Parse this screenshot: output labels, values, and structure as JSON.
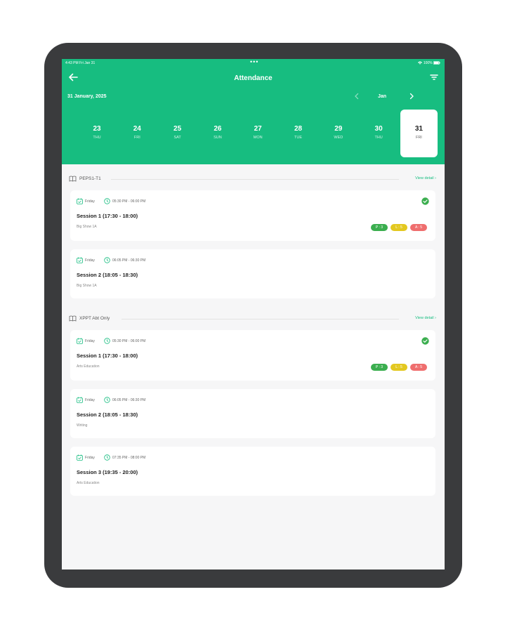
{
  "status_bar": {
    "time": "4:43 PM   Fri Jan 31",
    "dots": "•••",
    "battery": "100%"
  },
  "header": {
    "title": "Attendance",
    "date_text": "31 January, 2025",
    "month_label": "Jan"
  },
  "colors": {
    "accent": "#17bd80",
    "present": "#3bae4f",
    "late": "#e3c820",
    "absent": "#ef6e6e"
  },
  "icons": {
    "back": "arrow-left-icon",
    "filter": "filter-icon",
    "prev": "chevron-left-icon",
    "next": "chevron-right-icon",
    "class": "book-icon",
    "calendar": "calendar-icon",
    "clock": "clock-icon",
    "check": "check-circle-icon"
  },
  "days": [
    {
      "num": "23",
      "dow": "THU"
    },
    {
      "num": "24",
      "dow": "FRI"
    },
    {
      "num": "25",
      "dow": "SAT"
    },
    {
      "num": "26",
      "dow": "SUN"
    },
    {
      "num": "27",
      "dow": "MON"
    },
    {
      "num": "28",
      "dow": "TUE"
    },
    {
      "num": "29",
      "dow": "WED"
    },
    {
      "num": "30",
      "dow": "THU"
    },
    {
      "num": "31",
      "dow": "FRI",
      "selected": true
    }
  ],
  "groups": [
    {
      "name": "PEPS1-T1",
      "link": "View detail",
      "sessions": [
        {
          "day": "Friday",
          "time": "05:30 PM - 06:00 PM",
          "title": "Session 1 (17:30 - 18:00)",
          "subtitle": "Big Show 1A",
          "checked": true,
          "badges": {
            "present": "P : 3",
            "late": "L : 5",
            "absent": "A : 5"
          }
        },
        {
          "day": "Friday",
          "time": "06:05 PM - 06:30 PM",
          "title": "Session 2 (18:05 - 18:30)",
          "subtitle": "Big Show 1A"
        }
      ]
    },
    {
      "name": "XPPT Abt Only",
      "link": "View detail",
      "sessions": [
        {
          "day": "Friday",
          "time": "05:30 PM - 06:00 PM",
          "title": "Session 1 (17:30 - 18:00)",
          "subtitle": "Arts Education",
          "checked": true,
          "badges": {
            "present": "P : 3",
            "late": "L : 5",
            "absent": "A : 5"
          }
        },
        {
          "day": "Friday",
          "time": "06:05 PM - 06:30 PM",
          "title": "Session 2 (18:05 - 18:30)",
          "subtitle": "Writing"
        },
        {
          "day": "Friday",
          "time": "07:35 PM - 08:00 PM",
          "title": "Session 3 (19:35 - 20:00)",
          "subtitle": "Arts Education"
        }
      ]
    }
  ]
}
